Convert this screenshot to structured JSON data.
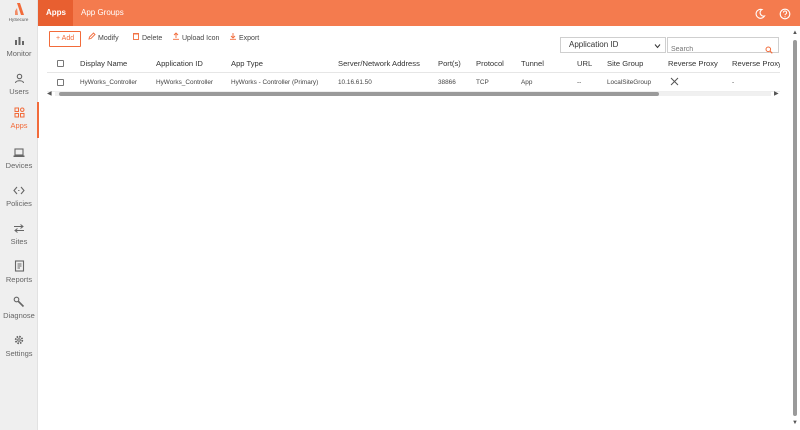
{
  "brand": {
    "name": "HySecure",
    "accent": "#f26b3a",
    "topbar": "#f47b4e"
  },
  "sidebar": {
    "items": [
      {
        "key": "monitor",
        "label": "Monitor",
        "icon": "bar-chart-icon"
      },
      {
        "key": "users",
        "label": "Users",
        "icon": "user-icon"
      },
      {
        "key": "apps",
        "label": "Apps",
        "icon": "apps-grid-icon",
        "active": true
      },
      {
        "key": "devices",
        "label": "Devices",
        "icon": "laptop-icon"
      },
      {
        "key": "policies",
        "label": "Policies",
        "icon": "code-brackets-icon"
      },
      {
        "key": "sites",
        "label": "Sites",
        "icon": "swap-arrows-icon"
      },
      {
        "key": "reports",
        "label": "Reports",
        "icon": "report-icon"
      },
      {
        "key": "diagnose",
        "label": "Diagnose",
        "icon": "tools-icon"
      },
      {
        "key": "settings",
        "label": "Settings",
        "icon": "gear-icon"
      }
    ]
  },
  "topbar": {
    "tabs": [
      {
        "label": "Apps",
        "active": true
      },
      {
        "label": "App Groups",
        "active": false
      }
    ]
  },
  "toolbar": {
    "add_label": "+ Add",
    "modify_label": "Modify",
    "delete_label": "Delete",
    "upload_label": "Upload Icon",
    "export_label": "Export"
  },
  "filter": {
    "selected": "Application ID",
    "search_placeholder": "Search"
  },
  "table": {
    "columns": [
      "Display Name",
      "Application ID",
      "App Type",
      "Server/Network Address",
      "Port(s)",
      "Protocol",
      "Tunnel",
      "URL",
      "Site Group",
      "Reverse Proxy",
      "Reverse Proxy I"
    ],
    "rows": [
      {
        "display_name": "HyWorks_Controller",
        "application_id": "HyWorks_Controller",
        "app_type": "HyWorks - Controller (Primary)",
        "server": "10.16.61.50",
        "ports": "38866",
        "protocol": "TCP",
        "tunnel": "App",
        "url": "--",
        "site_group": "LocalSiteGroup",
        "reverse_proxy": "x",
        "reverse_proxy_i": "-"
      }
    ]
  }
}
